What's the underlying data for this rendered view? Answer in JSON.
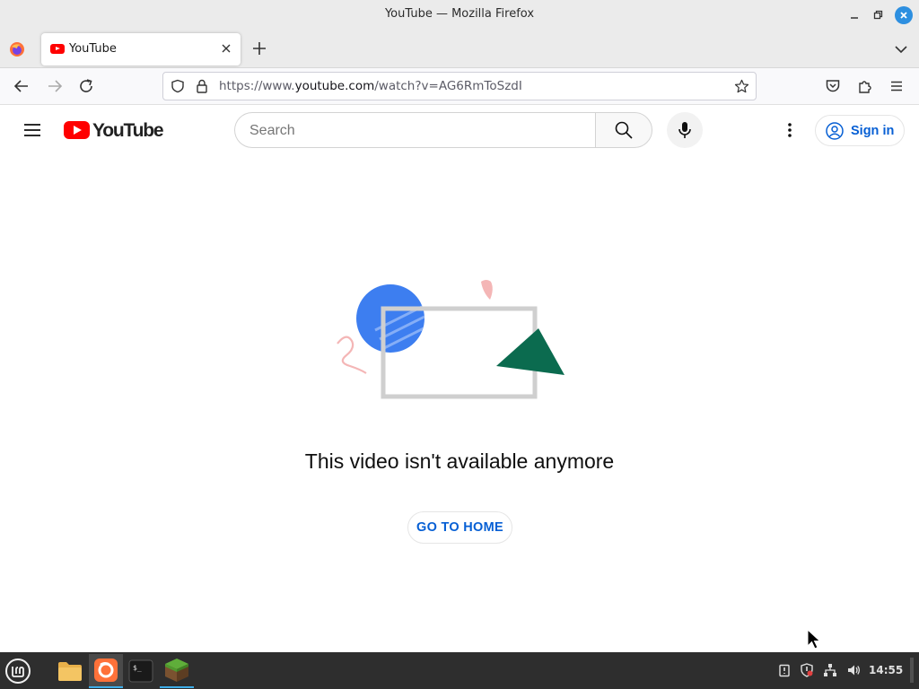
{
  "window": {
    "title": "YouTube — Mozilla Firefox"
  },
  "browser": {
    "tab": {
      "title": "YouTube"
    },
    "url": {
      "scheme_prefix": "https://www.",
      "domain": "youtube.com",
      "path": "/watch?v=AG6RmToSzdI"
    }
  },
  "youtube": {
    "logo_text": "YouTube",
    "search": {
      "placeholder": "Search",
      "value": ""
    },
    "sign_in_label": "Sign in",
    "error_message": "This video isn't available anymore",
    "go_home_label": "GO TO HOME"
  },
  "taskbar": {
    "clock": "14:55",
    "apps": [
      "files",
      "firefox",
      "terminal",
      "minecraft"
    ]
  },
  "colors": {
    "yt_red": "#ff0000",
    "link_blue": "#065fd4",
    "close_button_blue": "#2d8fe0",
    "illustration_blue": "#3d7ef0",
    "illustration_green": "#0b6b4f",
    "illustration_pink": "#f4b6b6"
  },
  "icons": {
    "titlebar": [
      "minimize-icon",
      "maximize-icon",
      "close-icon"
    ],
    "nav": [
      "back-arrow-icon",
      "forward-arrow-icon",
      "reload-icon",
      "shield-icon",
      "lock-icon",
      "star-icon",
      "pocket-icon",
      "extensions-icon",
      "hamburger-icon"
    ],
    "youtube": [
      "menu-icon",
      "search-icon",
      "mic-icon",
      "more-vert-icon",
      "account-icon"
    ],
    "tray": [
      "clipboard-icon",
      "update-shield-icon",
      "network-icon",
      "volume-icon"
    ]
  }
}
